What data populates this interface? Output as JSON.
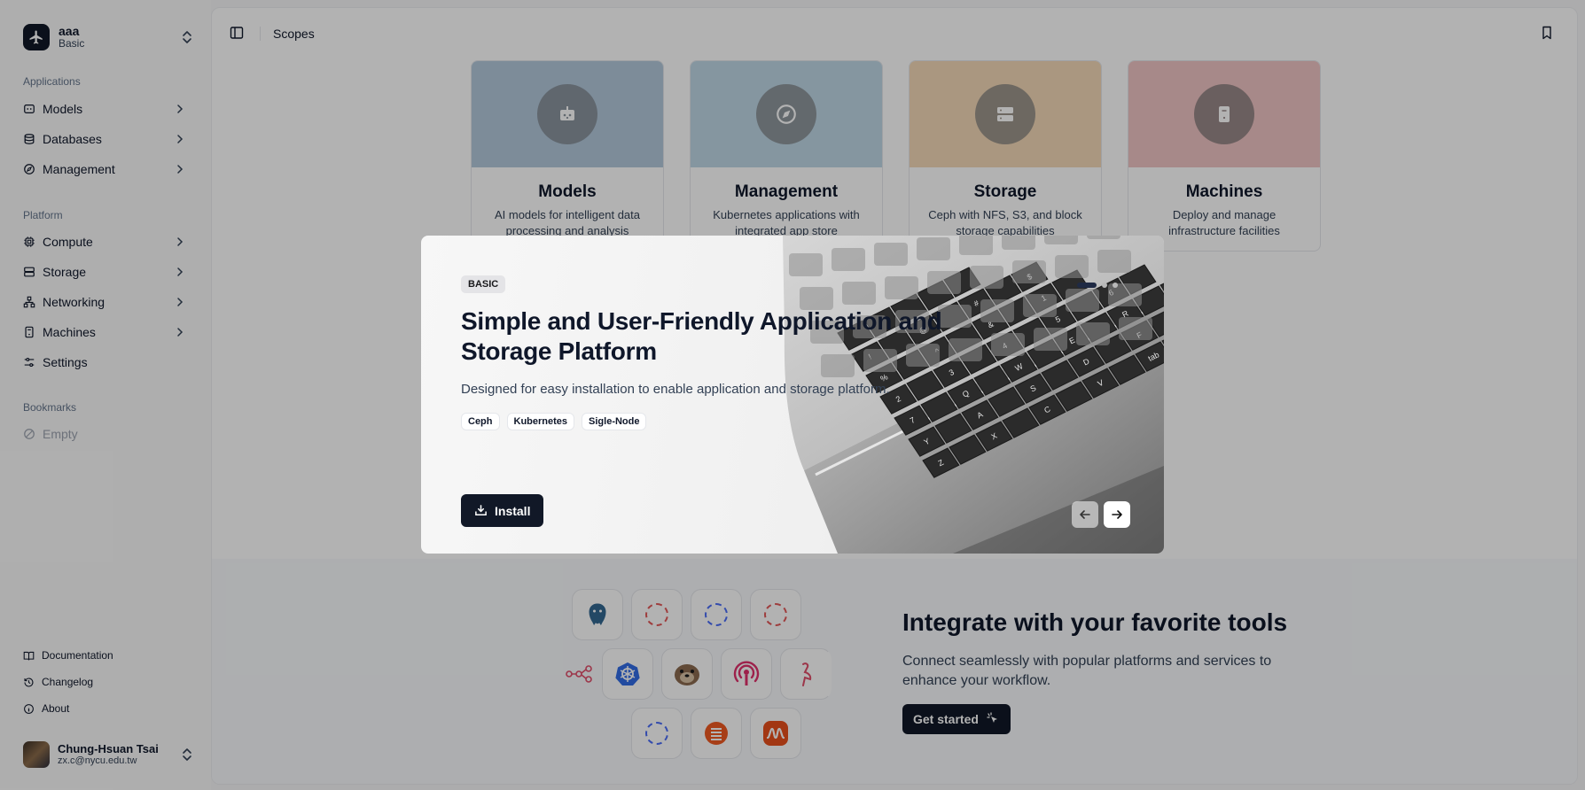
{
  "team": {
    "name": "aaa",
    "plan": "Basic"
  },
  "sidebar": {
    "applications_label": "Applications",
    "applications": [
      {
        "label": "Models",
        "icon": "models-icon"
      },
      {
        "label": "Databases",
        "icon": "database-icon"
      },
      {
        "label": "Management",
        "icon": "compass-icon"
      }
    ],
    "platform_label": "Platform",
    "platform": [
      {
        "label": "Compute",
        "icon": "cpu-icon"
      },
      {
        "label": "Storage",
        "icon": "server-icon"
      },
      {
        "label": "Networking",
        "icon": "network-icon"
      },
      {
        "label": "Machines",
        "icon": "machine-icon"
      },
      {
        "label": "Settings",
        "icon": "sliders-icon"
      }
    ],
    "bookmarks_label": "Bookmarks",
    "bookmarks_empty": "Empty",
    "footer": [
      {
        "label": "Documentation",
        "icon": "book-icon"
      },
      {
        "label": "Changelog",
        "icon": "history-icon"
      },
      {
        "label": "About",
        "icon": "info-icon"
      }
    ]
  },
  "user": {
    "name": "Chung-Hsuan Tsai",
    "email": "zx.c@nycu.edu.tw"
  },
  "header": {
    "breadcrumb": "Scopes"
  },
  "cards": [
    {
      "title": "Models",
      "description": "AI models for intelligent data processing and analysis",
      "color": "#b3c9dc",
      "icon": "bot-icon"
    },
    {
      "title": "Management",
      "description": "Kubernetes applications with integrated app store",
      "color": "#bfd7e6",
      "icon": "compass-icon"
    },
    {
      "title": "Storage",
      "description": "Ceph with NFS, S3, and block storage capabilities",
      "color": "#f4d9b8",
      "icon": "server-icon"
    },
    {
      "title": "Machines",
      "description": "Deploy and manage infrastructure facilities",
      "color": "#efc4c4",
      "icon": "machine-icon"
    }
  ],
  "integrations": {
    "title": "Integrate with your favorite tools",
    "description": "Connect seamlessly with popular platforms and services to enhance your workflow.",
    "button": "Get started"
  },
  "modal": {
    "badge": "BASIC",
    "title": "Simple and User-Friendly Application and Storage Platform",
    "description": "Designed for easy installation to enable application and storage platform.",
    "tags": [
      "Ceph",
      "Kubernetes",
      "Sigle-Node"
    ],
    "install_label": "Install",
    "slides_total": 3,
    "active_slide": 1,
    "keyboard_keys": [
      "!",
      "@",
      "#",
      "$",
      "%",
      "^",
      "&",
      "1",
      "2",
      "3",
      "4",
      "5",
      "6",
      "7",
      "Q",
      "W",
      "E",
      "R",
      "T",
      "Y",
      "A",
      "S",
      "D",
      "F",
      "G",
      "Z",
      "X",
      "C",
      "V",
      "tab",
      "command"
    ]
  }
}
